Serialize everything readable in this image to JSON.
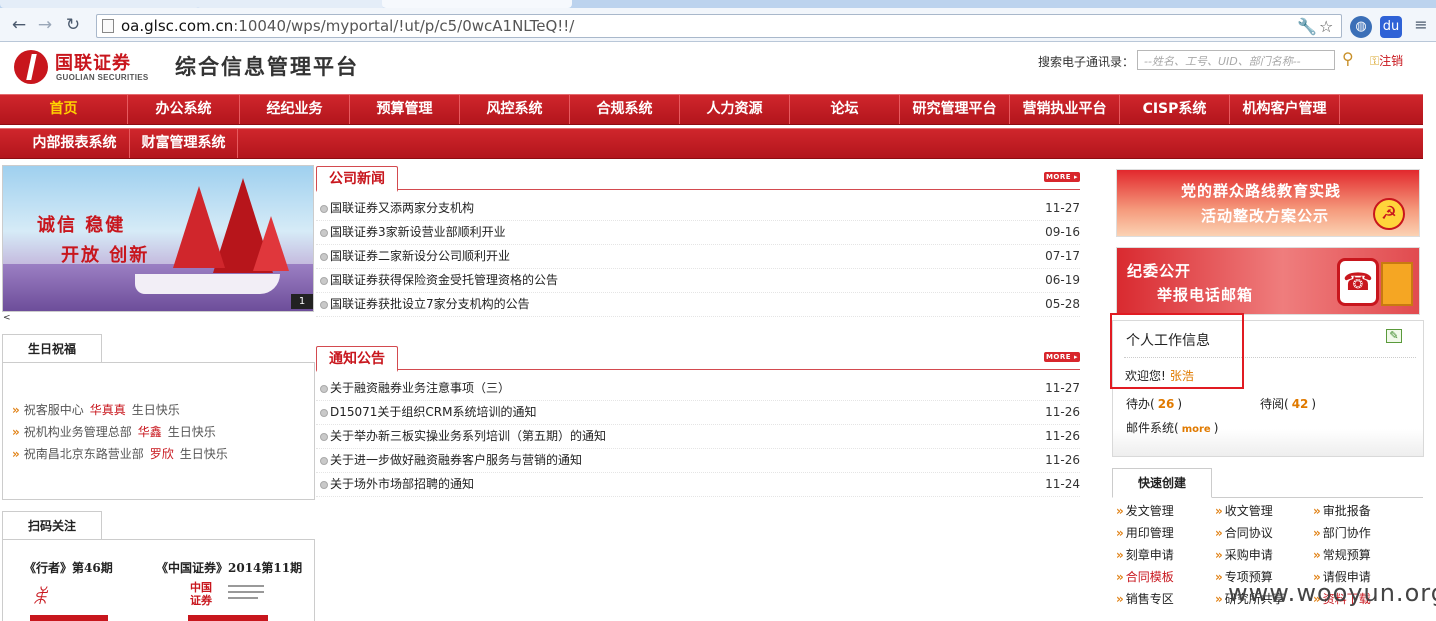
{
  "browser": {
    "url_host": "oa.glsc.com.cn",
    "url_rest": ":10040/wps/myportal/!ut/p/c5/0wcA1NLTeQ!!/"
  },
  "header": {
    "logo_cn": "国联证券",
    "logo_en": "GUOLIAN SECURITIES",
    "platform_title": "综合信息管理平台",
    "search_label": "搜索电子通讯录：",
    "search_placeholder": "--姓名、工号、UID、部门名称--",
    "logout": "注销"
  },
  "nav_primary": [
    "首页",
    "办公系统",
    "经纪业务",
    "预算管理",
    "风控系统",
    "合规系统",
    "人力资源",
    "论坛",
    "研究管理平台",
    "营销执业平台",
    "CISP系统",
    "机构客户管理"
  ],
  "nav_secondary": [
    "内部报表系统",
    "财富管理系统"
  ],
  "banner": {
    "slogan_1": "诚信 稳健",
    "slogan_2": "开放 创新",
    "slide_number": "1",
    "prev_arrow": "<"
  },
  "birthday": {
    "tab": "生日祝福",
    "items": [
      {
        "pre": "祝客服中心",
        "name": "华真真",
        "post": "生日快乐"
      },
      {
        "pre": "祝机构业务管理总部",
        "name": "华鑫",
        "post": "生日快乐"
      },
      {
        "pre": "祝南昌北京东路营业部",
        "name": "罗欣",
        "post": "生日快乐"
      }
    ]
  },
  "scan": {
    "tab": "扫码关注",
    "mag1": "《行者》第46期",
    "mag2": "《中国证券》2014第11期",
    "mag2_cover_text": "中国证券"
  },
  "company_news": {
    "tab": "公司新闻",
    "more": "MORE",
    "items": [
      {
        "title": "国联证券又添两家分支机构",
        "date": "11-27"
      },
      {
        "title": "国联证券3家新设营业部顺利开业",
        "date": "09-16"
      },
      {
        "title": "国联证券二家新设分公司顺利开业",
        "date": "07-17"
      },
      {
        "title": "国联证券获得保险资金受托管理资格的公告",
        "date": "06-19"
      },
      {
        "title": "国联证券获批设立7家分支机构的公告",
        "date": "05-28"
      }
    ]
  },
  "notices": {
    "tab": "通知公告",
    "more": "MORE",
    "items": [
      {
        "title": "关于融资融券业务注意事项（三）",
        "date": "11-27"
      },
      {
        "title": "D15071关于组织CRM系统培训的通知",
        "date": "11-26"
      },
      {
        "title": "关于举办新三板实操业务系列培训（第五期）的通知",
        "date": "11-26"
      },
      {
        "title": "关于进一步做好融资融券客户服务与营销的通知",
        "date": "11-26"
      },
      {
        "title": "关于场外市场部招聘的通知",
        "date": "11-24"
      }
    ]
  },
  "right_banners": {
    "b1_line1": "党的群众路线教育实践",
    "b1_line2": "活动整改方案公示",
    "b2_line1": "纪委公开",
    "b2_line2": "举报电话邮箱"
  },
  "work_info": {
    "title": "个人工作信息",
    "welcome": "欢迎您!",
    "user": "张浩",
    "todo_label": "待办(",
    "todo_count": "26",
    "read_label": "待阅(",
    "read_count": "42",
    "mail_label": "邮件系统(",
    "mail_more": "more",
    "close_paren": ")"
  },
  "quick_create": {
    "tab": "快速创建",
    "items": [
      [
        "发文管理",
        "收文管理",
        "审批报备"
      ],
      [
        "用印管理",
        "合同协议",
        "部门协作"
      ],
      [
        "刻章申请",
        "采购申请",
        "常规预算"
      ],
      [
        "合同模板",
        "专项预算",
        "请假申请"
      ],
      [
        "销售专区",
        "研究所共享",
        "资料下载"
      ]
    ]
  },
  "watermark": "www.wooyun.org",
  "colors": {
    "brand_red": "#c8161d",
    "nav_active": "#ffd200",
    "accent_orange": "#e07a00"
  }
}
